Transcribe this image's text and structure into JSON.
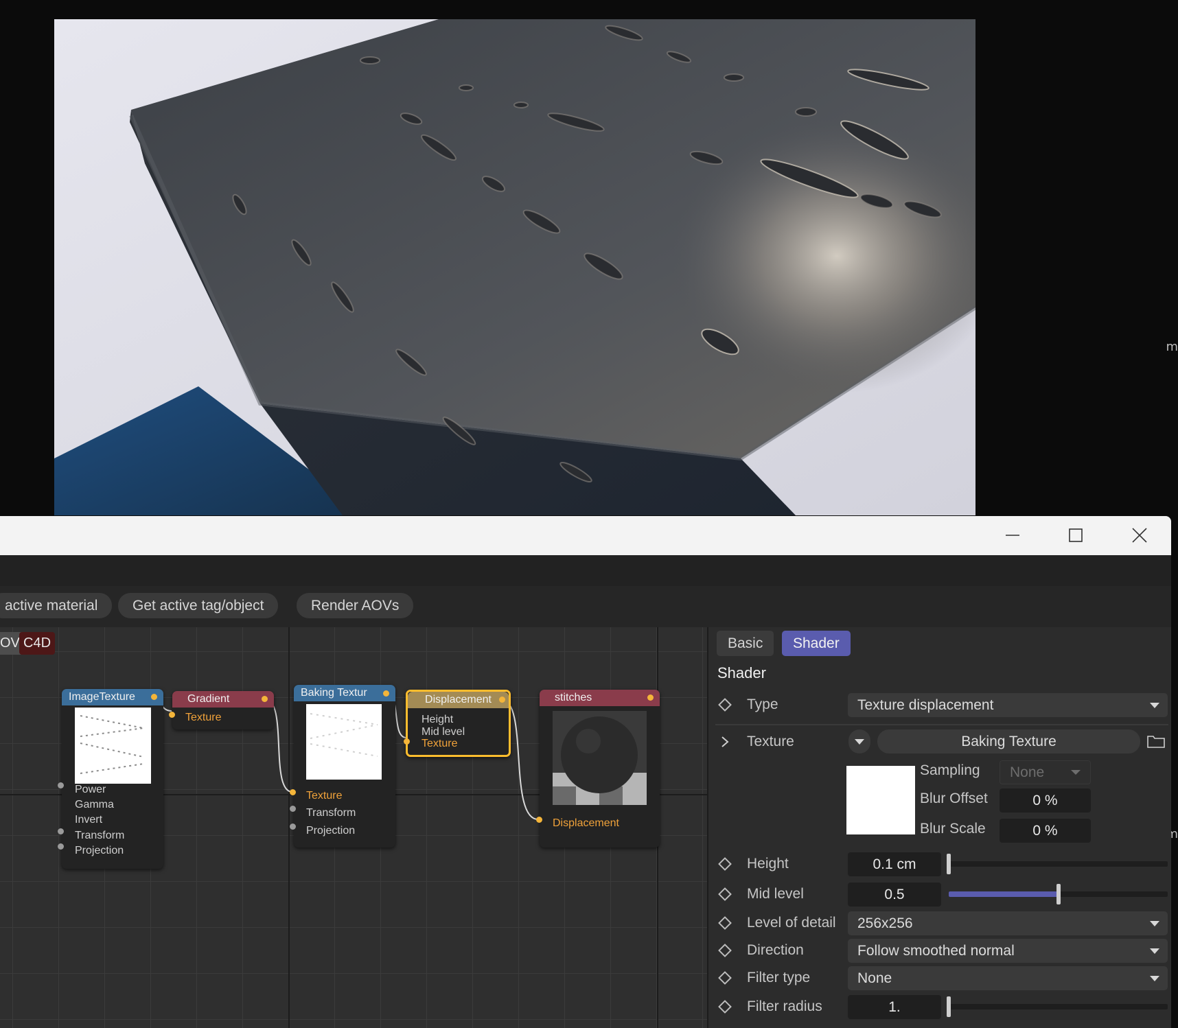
{
  "render_view": {
    "right_edge_glyphs": [
      "m",
      "m"
    ]
  },
  "window": {
    "controls": {
      "minimize": "minimize",
      "maximize": "maximize",
      "close": "close"
    }
  },
  "toolbar": {
    "buttons": [
      "active material",
      "Get active tag/object",
      "Render AOVs"
    ]
  },
  "graph": {
    "tags": [
      "OV",
      "C4D"
    ],
    "nodes": {
      "image_texture": {
        "title": "ImageTexture",
        "inputs": [
          "Power",
          "Gamma",
          "Invert",
          "Transform",
          "Projection"
        ]
      },
      "gradient": {
        "title": "Gradient",
        "inputs": [
          "Texture"
        ]
      },
      "baking_texture": {
        "title": "Baking Textur",
        "inputs": [
          "Texture",
          "Transform",
          "Projection"
        ]
      },
      "displacement": {
        "title": "Displacement",
        "inputs": [
          "Height",
          "Mid level",
          "Texture"
        ]
      },
      "stitches": {
        "title": "stitches",
        "inputs": [
          "Displacement"
        ]
      }
    }
  },
  "panel": {
    "tabs": [
      "Basic",
      "Shader"
    ],
    "active_tab": "Shader",
    "section_title": "Shader",
    "type": {
      "label": "Type",
      "value": "Texture displacement"
    },
    "texture": {
      "label": "Texture",
      "value": "Baking Texture"
    },
    "sampling": {
      "label": "Sampling",
      "value": "None"
    },
    "blur_offset": {
      "label": "Blur Offset",
      "value": "0 %"
    },
    "blur_scale": {
      "label": "Blur Scale",
      "value": "0 %"
    },
    "height": {
      "label": "Height",
      "value": "0.1 cm",
      "slider_fraction": 0.0
    },
    "mid_level": {
      "label": "Mid level",
      "value": "0.5",
      "slider_fraction": 0.5
    },
    "level_of_detail": {
      "label": "Level of detail",
      "value": "256x256"
    },
    "direction": {
      "label": "Direction",
      "value": "Follow smoothed normal"
    },
    "filter_type": {
      "label": "Filter type",
      "value": "None"
    },
    "filter_radius": {
      "label": "Filter radius",
      "value": "1.",
      "slider_fraction": 0.0
    }
  },
  "colors": {
    "accent": "#5a5cae",
    "port": "#f4b53a",
    "node_selected": "#ffbd2e",
    "header_blue": "#3b6e9a",
    "header_red": "#8a3c4b"
  }
}
